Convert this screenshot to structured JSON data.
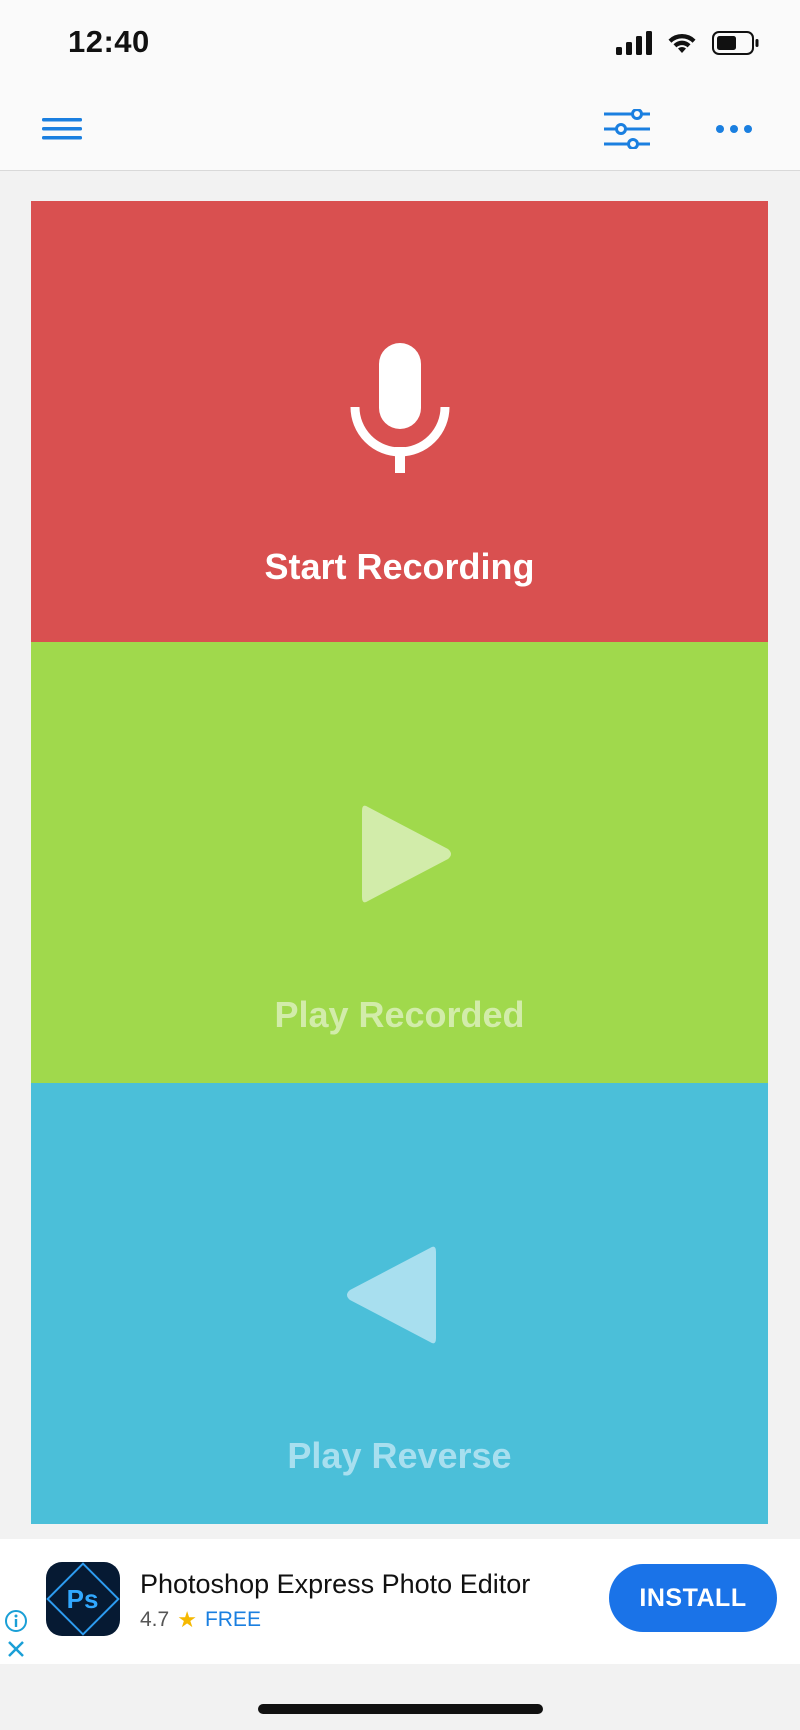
{
  "status_bar": {
    "time": "12:40"
  },
  "nav": {
    "menu_icon": "hamburger-menu-icon",
    "settings_icon": "sliders-icon",
    "more_icon": "more-dots-icon",
    "accent_color": "#1a7fe0"
  },
  "panels": {
    "record": {
      "label": "Start Recording",
      "icon": "microphone-icon",
      "color": "#d95050"
    },
    "play": {
      "label": "Play Recorded",
      "icon": "play-icon",
      "color": "#a0d94c"
    },
    "reverse": {
      "label": "Play Reverse",
      "icon": "reverse-play-icon",
      "color": "#4bbfd9"
    }
  },
  "ad": {
    "logo_text": "Ps",
    "title": "Photoshop Express Photo Editor",
    "rating": "4.7",
    "rating_icon": "star-icon",
    "price": "FREE",
    "install_label": "INSTALL",
    "install_color": "#1a73e8"
  }
}
